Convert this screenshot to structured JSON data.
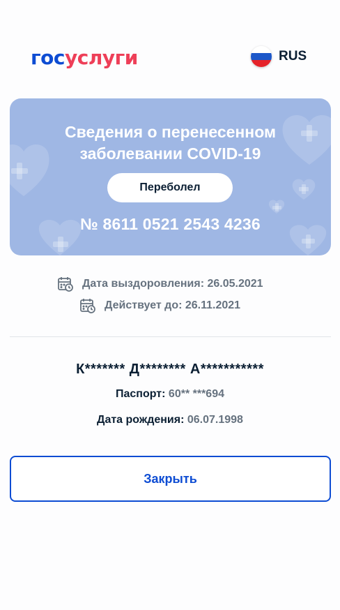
{
  "header": {
    "logo_part1": "гос",
    "logo_part2": "услуги",
    "language": "RUS",
    "flag_colors": [
      "#ffffff",
      "#1c57c9",
      "#e52229"
    ]
  },
  "card": {
    "title_line1": "Сведения о перенесенном",
    "title_line2": "заболевании COVID-19",
    "status": "Переболел",
    "number": "№ 8611 0521 2543 4236",
    "background_color": "#9fb7e4"
  },
  "dates": {
    "recovery": "Дата выздоровления: 26.05.2021",
    "valid_until": "Действует до: 26.11.2021"
  },
  "person": {
    "name": "К******* Д******** А***********",
    "passport_label": "Паспорт:",
    "passport_value": "60** ***694",
    "birth_label": "Дата рождения:",
    "birth_value": "06.07.1998"
  },
  "actions": {
    "close_label": "Закрыть"
  },
  "colors": {
    "brand_blue": "#0d4cd3",
    "brand_red": "#ee3f58",
    "text_dark": "#0b1f33",
    "text_gray": "#66727f"
  }
}
